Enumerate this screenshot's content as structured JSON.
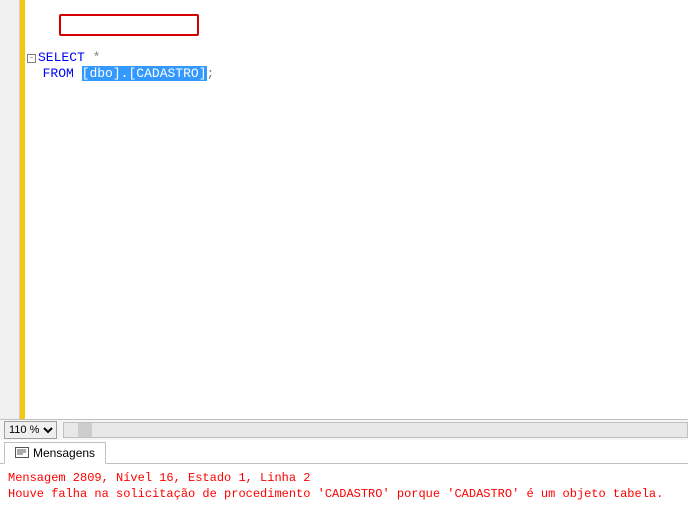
{
  "zoom": {
    "value": "110 %"
  },
  "sql": {
    "select_kw": "SELECT",
    "star": "*",
    "from_kw": "FROM",
    "schema_open": "[",
    "schema": "dbo",
    "schema_close": "]",
    "dot": ".",
    "table_open": "[",
    "table": "CADASTRO",
    "table_close": "]",
    "semi": ";"
  },
  "tabs": {
    "messages": "Mensagens"
  },
  "message": {
    "line1": "Mensagem 2809, Nível 16, Estado 1, Linha 2",
    "line2": "Houve falha na solicitação de procedimento 'CADASTRO' porque 'CADASTRO' é um objeto tabela."
  }
}
